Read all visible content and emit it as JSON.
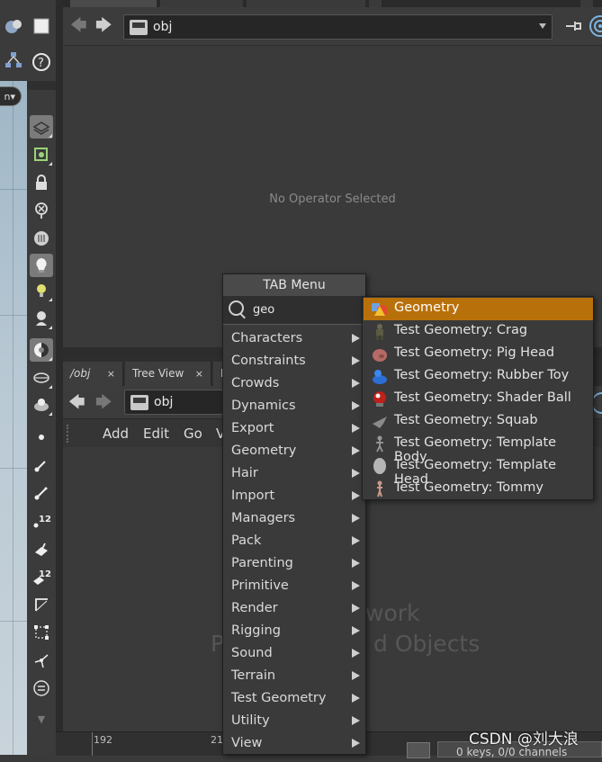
{
  "top_pane": {
    "path": "obj",
    "message": "No Operator Selected"
  },
  "network_pane": {
    "tabs": [
      "/obj",
      "Tree View",
      "M"
    ],
    "path": "obj",
    "menu": [
      "Add",
      "Edit",
      "Go",
      "V"
    ],
    "watermark_lines": [
      "work",
      "d Objects"
    ]
  },
  "viewport": {
    "view_label": "n"
  },
  "toolbar": {
    "badge_12": "12"
  },
  "timeline": {
    "ticks": [
      "192",
      "21"
    ],
    "status": "0 keys, 0/0 channels"
  },
  "watermark": "CSDN @刘大浪",
  "tab_menu": {
    "title": "TAB Menu",
    "search_value": "geo",
    "categories": [
      "Characters",
      "Constraints",
      "Crowds",
      "Dynamics",
      "Export",
      "Geometry",
      "Hair",
      "Import",
      "Managers",
      "Pack",
      "Parenting",
      "Primitive",
      "Render",
      "Rigging",
      "Sound",
      "Terrain",
      "Test Geometry",
      "Utility",
      "View"
    ]
  },
  "submenu": {
    "items": [
      {
        "label": "Geometry",
        "icon": "geometry-icon",
        "highlighted": true
      },
      {
        "label": "Test Geometry: Crag",
        "icon": "crag-icon"
      },
      {
        "label": "Test Geometry: Pig Head",
        "icon": "pig-head-icon"
      },
      {
        "label": "Test Geometry: Rubber Toy",
        "icon": "rubber-toy-icon"
      },
      {
        "label": "Test Geometry: Shader Ball",
        "icon": "shader-ball-icon"
      },
      {
        "label": "Test Geometry: Squab",
        "icon": "squab-icon"
      },
      {
        "label": "Test Geometry: Template Body",
        "icon": "template-body-icon"
      },
      {
        "label": "Test Geometry: Template Head",
        "icon": "template-head-icon"
      },
      {
        "label": "Test Geometry: Tommy",
        "icon": "tommy-icon"
      }
    ],
    "highlight_color": "#b8700a"
  }
}
